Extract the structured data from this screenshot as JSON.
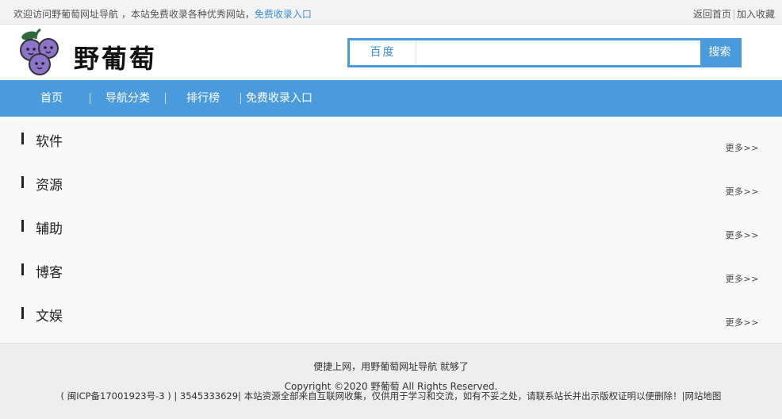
{
  "topbar": {
    "welcome_text": "欢迎访问野葡萄网址导航 ，本站免费收录各种优秀网站，",
    "welcome_link": "免费收录入口",
    "back_home": "返回首页",
    "add_favorite": "加入收藏"
  },
  "header": {
    "logo_text": "野葡萄",
    "search_engine": "百度",
    "search_placeholder": "",
    "search_button": "搜索"
  },
  "nav": {
    "items": [
      {
        "label": "首页"
      },
      {
        "label": "导航分类"
      },
      {
        "label": "排行榜"
      },
      {
        "label": "免费收录入口"
      }
    ]
  },
  "categories": [
    {
      "title": "软件",
      "more": "更多>>"
    },
    {
      "title": "资源",
      "more": "更多>>"
    },
    {
      "title": "辅助",
      "more": "更多>>"
    },
    {
      "title": "博客",
      "more": "更多>>"
    },
    {
      "title": "文娱",
      "more": "更多>>"
    }
  ],
  "footer": {
    "slogan": "便捷上网，用野葡萄网址导航 就够了",
    "copyright": "Copyright ©2020 野葡萄 All Rights Reserved.",
    "icp": "( 闽ICP备17001923号-3  ) | 3545333629| 本站资源全部来自互联网收集，仅供用于学习和交流，如有不妥之处，请联系站长并出示版权证明以便删除！|",
    "sitemap": "网站地图"
  },
  "colors": {
    "accent": "#4a9bdd",
    "link": "#3b8fd8",
    "grape": "#8b74c9",
    "leaf": "#2f6b3a"
  }
}
